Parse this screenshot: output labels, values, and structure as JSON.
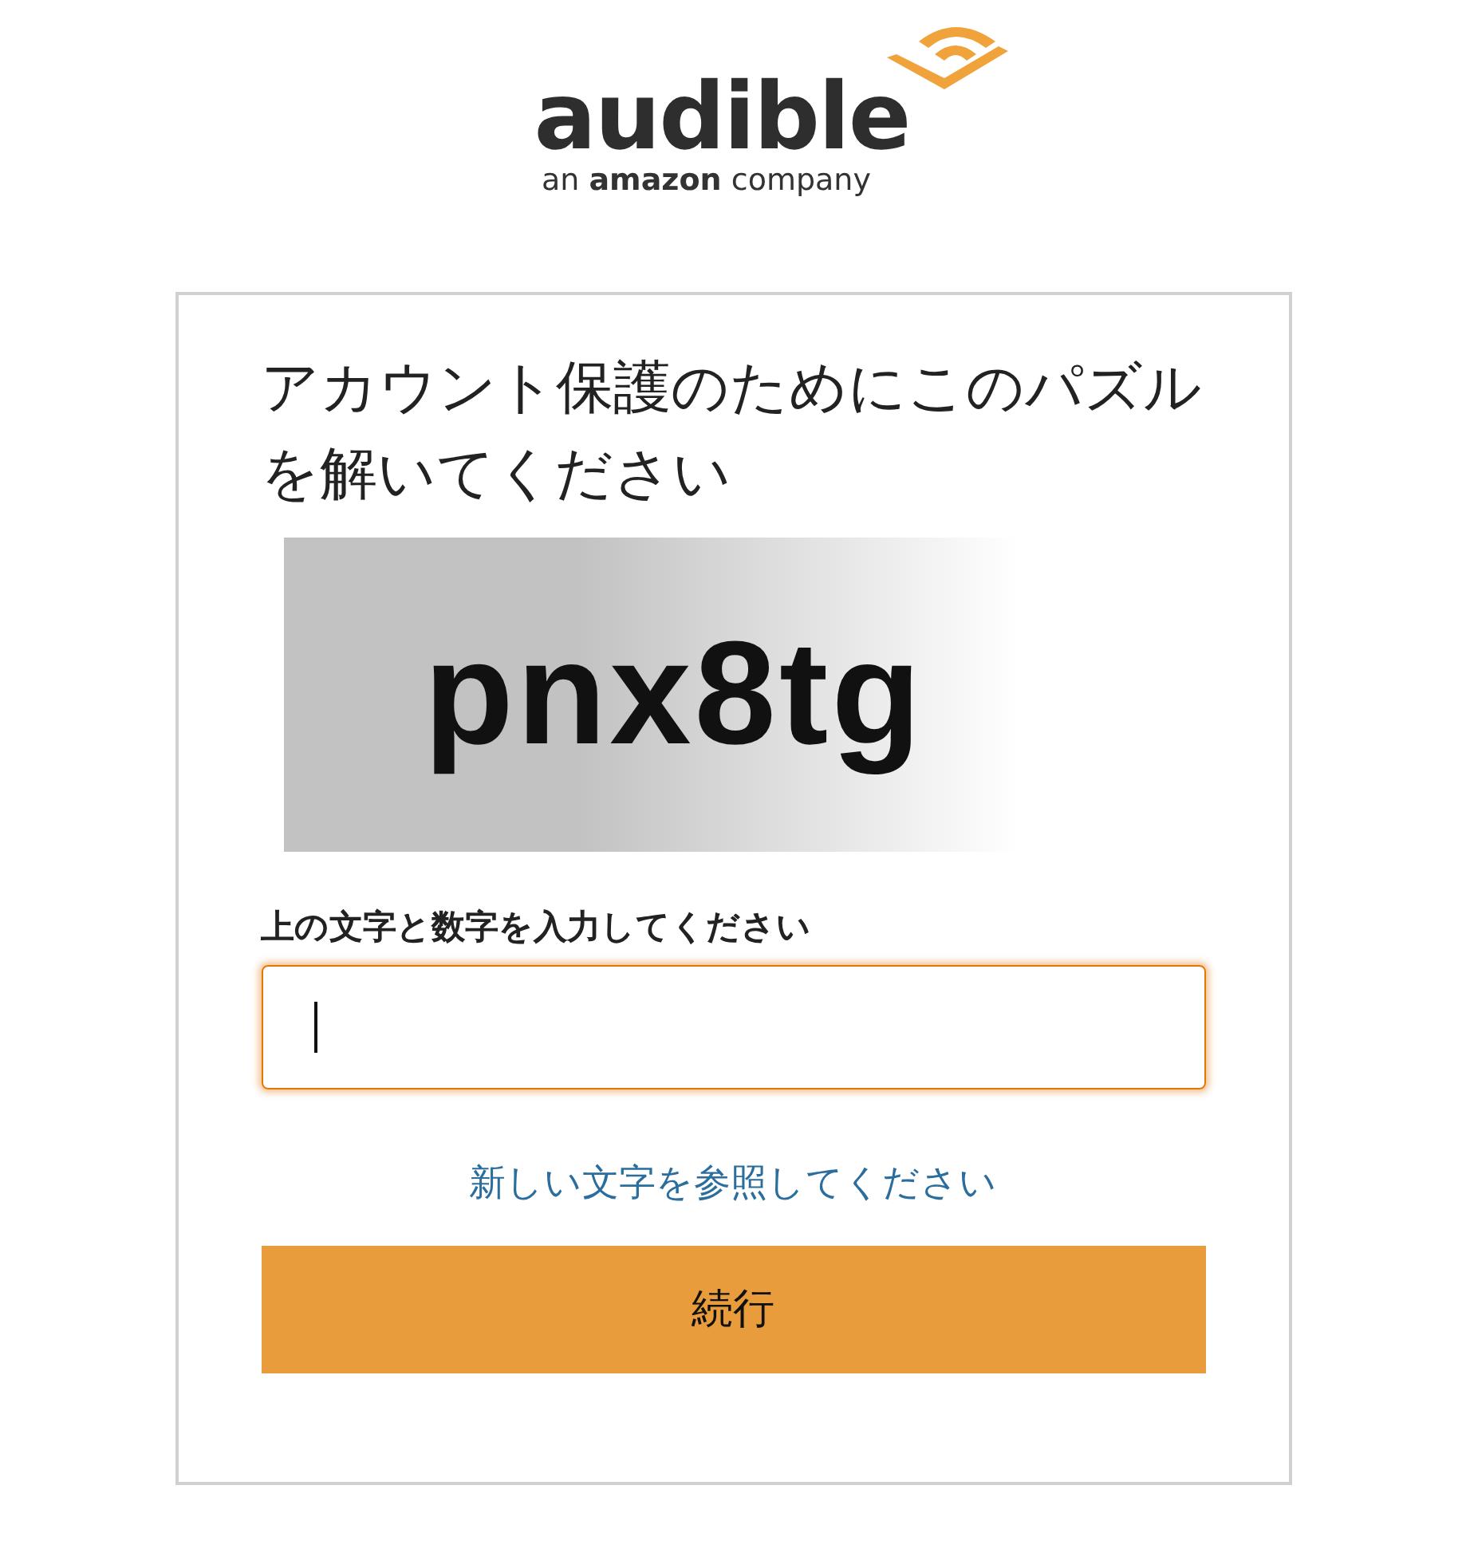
{
  "logo": {
    "wordmark": "audible",
    "tagline": "an **amazon** company"
  },
  "card": {
    "heading": "アカウント保護のためにこのパズルを解いてください",
    "captcha": {
      "text": "pnx8tg"
    },
    "field": {
      "label": "上の文字と数字を入力してください",
      "focused": true
    },
    "link": "新しい文字を参照してください",
    "button": "続行"
  }
}
